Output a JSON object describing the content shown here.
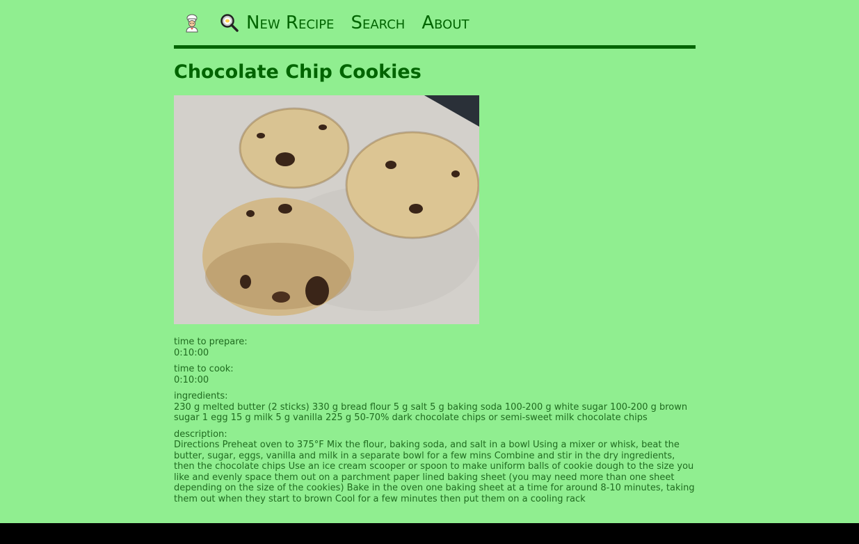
{
  "nav": {
    "logo_icon": "chef-icon",
    "new_recipe_icon": "magnifier-pan-icon",
    "new_recipe_label": "New Recipe",
    "search_label": "Search",
    "about_label": "About"
  },
  "recipe": {
    "title": "Chocolate Chip Cookies",
    "prep_label": "time to prepare:",
    "prep_value": "0:10:00",
    "cook_label": "time to cook:",
    "cook_value": "0:10:00",
    "ingredients_label": "ingredients:",
    "ingredients_value": "230 g melted butter (2 sticks) 330 g bread flour 5 g salt 5 g baking soda 100-200 g white sugar 100-200 g brown sugar 1 egg 15 g milk 5 g vanilla 225 g 50-70% dark chocolate chips or semi-sweet milk chocolate chips",
    "description_label": "description:",
    "description_value": "Directions Preheat oven to 375°F Mix the flour, baking soda, and salt in a bowl Using a mixer or whisk, beat the butter, sugar, eggs, vanilla and milk in a separate bowl for a few mins Combine and stir in the dry ingredients, then the chocolate chips Use an ice cream scooper or spoon to make uniform balls of cookie dough to the size you like and evenly space them out on a parchment paper lined baking sheet (you may need more than one sheet depending on the size of the cookies) Bake in the oven one baking sheet at a time for around 8-10 minutes, taking them out when they start to brown Cool for a few minutes then put them on a cooling rack"
  }
}
